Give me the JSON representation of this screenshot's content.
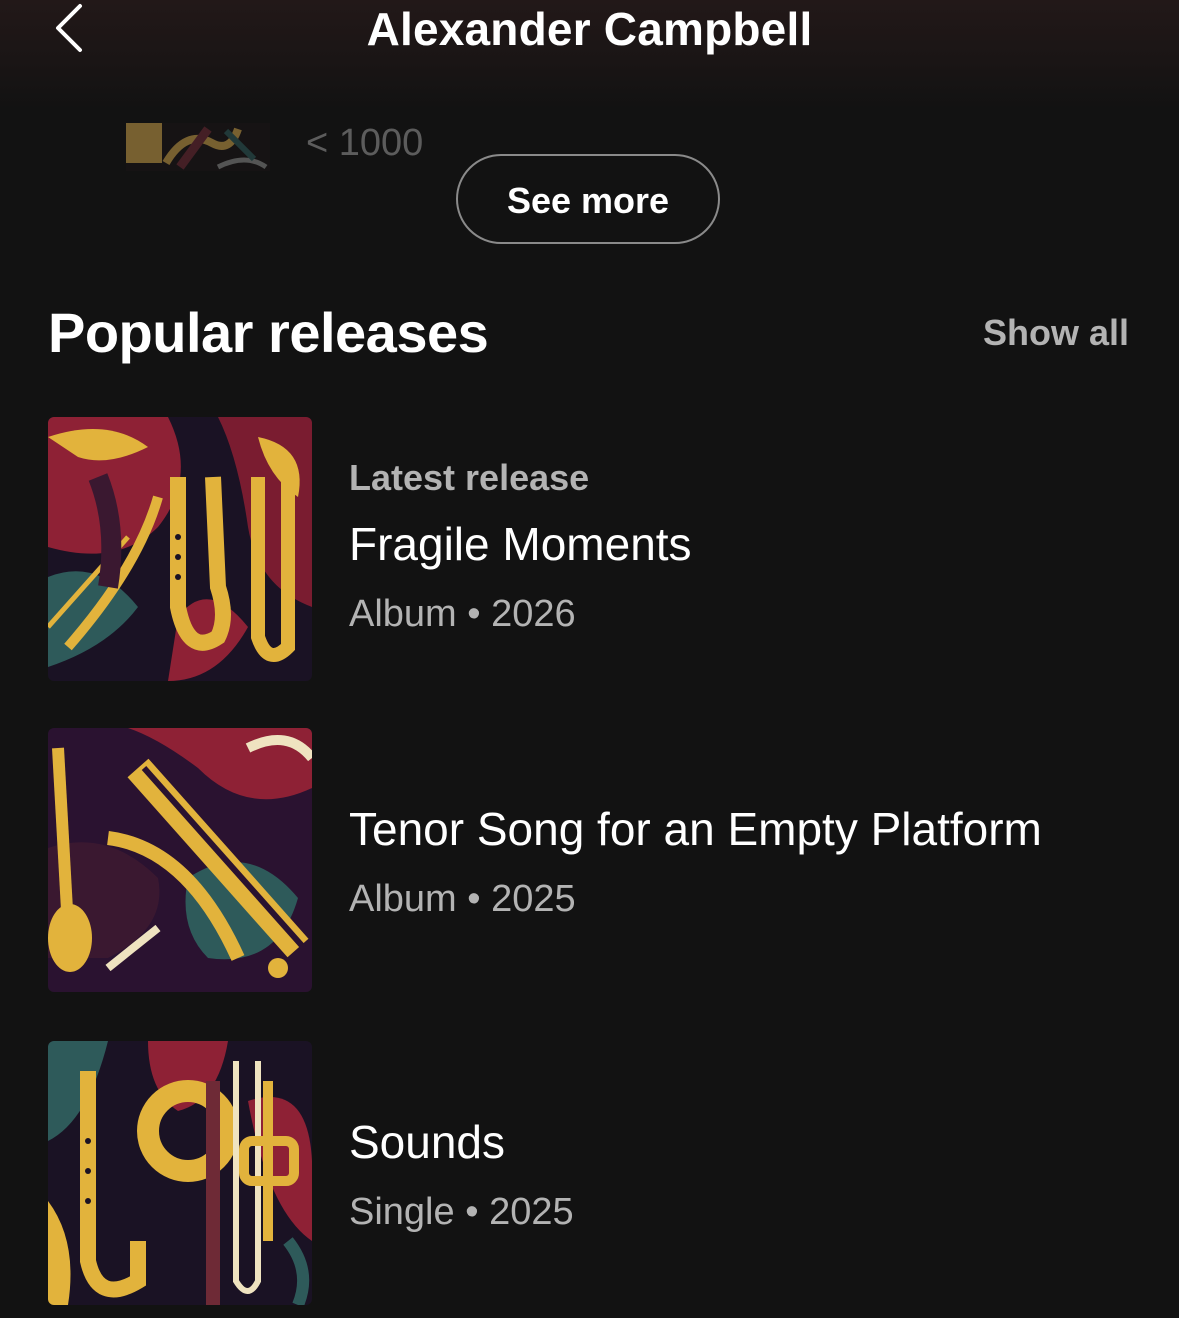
{
  "header": {
    "title": "Alexander Campbell",
    "back_icon": "chevron-left-icon"
  },
  "overflow_item": {
    "count": "< 1000"
  },
  "see_more_label": "See more",
  "popular": {
    "title": "Popular releases",
    "show_all_label": "Show all",
    "items": [
      {
        "eyebrow": "Latest release",
        "title": "Fragile Moments",
        "type": "Album",
        "separator": "•",
        "year": "2026"
      },
      {
        "eyebrow": "",
        "title": "Tenor Song for an Empty Platform",
        "type": "Album",
        "separator": "•",
        "year": "2025"
      },
      {
        "eyebrow": "",
        "title": "Sounds",
        "type": "Single",
        "separator": "•",
        "year": "2025"
      }
    ]
  },
  "colors": {
    "background": "#121212",
    "text_primary": "#ffffff",
    "text_secondary": "#b3b3b3",
    "art_gold": "#e2b33c",
    "art_crimson": "#8e2135",
    "art_teal": "#2e5a5a",
    "art_plum": "#3a1830"
  }
}
